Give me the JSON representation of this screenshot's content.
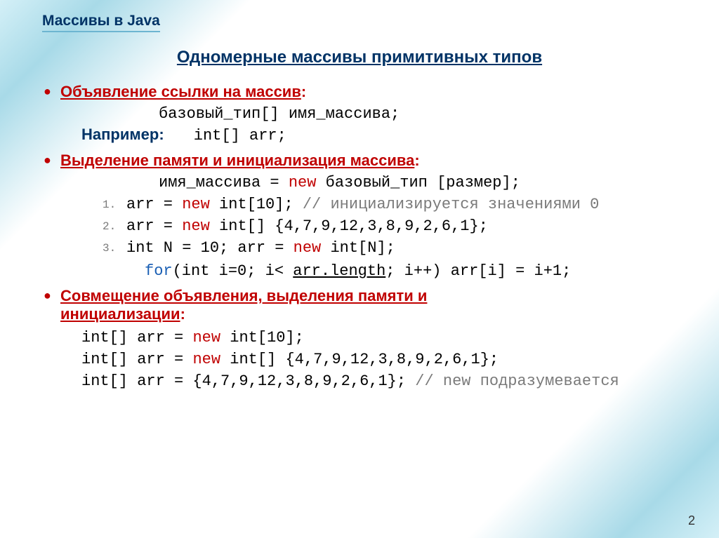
{
  "breadcrumb": "Массивы в Java",
  "title": "Одномерные массивы примитивных типов",
  "s1": {
    "heading": "Объявление ссылки на массив",
    "syntax": "базовый_тип[] имя_массива;",
    "eg_label": "Например:",
    "eg_code": "int[] arr;"
  },
  "s2": {
    "heading": "Выделение памяти и инициализация массива",
    "syntax_pre": "имя_массива = ",
    "syntax_new": "new",
    "syntax_post": " базовый_тип [размер];",
    "l1_a": "arr = ",
    "l1_new": "new",
    "l1_b": " int[10]; ",
    "l1_c": "// инициализируется значениями 0",
    "l2_a": "arr = ",
    "l2_new": "new",
    "l2_b": " int[] {4,7,9,12,3,8,9,2,6,1};",
    "l3_a": "int N = 10; arr = ",
    "l3_new": "new",
    "l3_b": " int[N];",
    "for_kw": "for",
    "for_a": "(int i=0; i< ",
    "for_len": "arr.length",
    "for_b": "; i++) arr[i] = i+1;"
  },
  "s3": {
    "heading_a": "Совмещение объявления, выделения памяти и",
    "heading_b": "инициализации",
    "l1_a": "int[] arr = ",
    "l1_new": "new",
    "l1_b": " int[10];",
    "l2_a": "int[] arr = ",
    "l2_new": "new",
    "l2_b": " int[] {4,7,9,12,3,8,9,2,6,1};",
    "l3_a": "int[] arr = {4,7,9,12,3,8,9,2,6,1}; ",
    "l3_c": "// new подразумевается"
  },
  "nums": {
    "n1": "1.",
    "n2": "2.",
    "n3": "3."
  },
  "page": "2"
}
